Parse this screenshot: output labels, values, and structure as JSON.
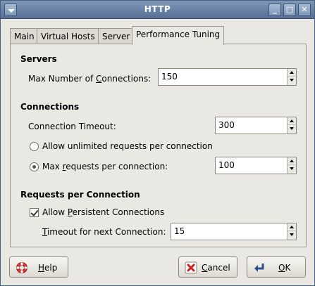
{
  "window": {
    "title": "HTTP"
  },
  "tabs": [
    {
      "label": "Main"
    },
    {
      "label": "Virtual Hosts"
    },
    {
      "label": "Server"
    },
    {
      "label": "Performance Tuning"
    }
  ],
  "servers": {
    "heading": "Servers",
    "max_connections_label": "Max Number of Connections:",
    "max_connections_value": "150"
  },
  "connections": {
    "heading": "Connections",
    "timeout_label": "Connection Timeout:",
    "timeout_value": "300",
    "unlimited_label": "Allow unlimited requests per connection",
    "max_requests_label": "Max requests per connection:",
    "max_requests_value": "100",
    "selected": "max"
  },
  "requests": {
    "heading": "Requests per Connection",
    "persistent_label": "Allow Persistent Connections",
    "persistent_checked": true,
    "next_timeout_label": "Timeout for next Connection:",
    "next_timeout_value": "15"
  },
  "buttons": {
    "help": "Help",
    "cancel": "Cancel",
    "ok": "OK"
  },
  "colors": {
    "titlebar": "#566f94",
    "background": "#eae8e3"
  }
}
